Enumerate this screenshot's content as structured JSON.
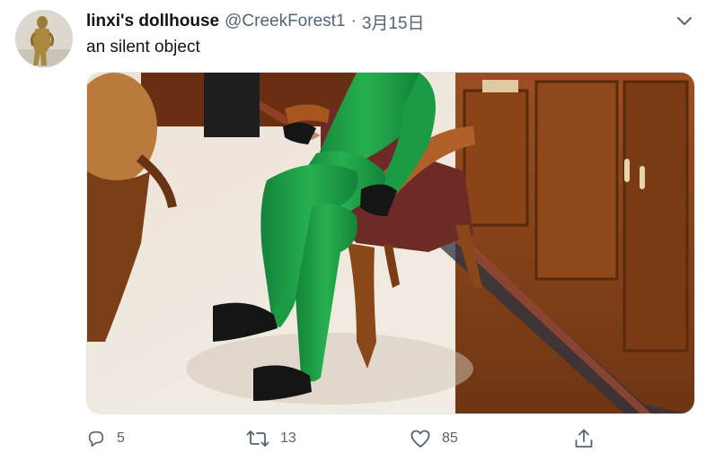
{
  "tweet": {
    "display_name": "linxi's dollhouse",
    "handle": "@CreekForest1",
    "separator": "·",
    "date": "3月15日",
    "text": "an silent object",
    "avatar_icon": "avatar-figure",
    "more_icon": "chevron-down-icon",
    "media_alt": "photo"
  },
  "actions": {
    "reply": {
      "icon": "reply-icon",
      "count": "5"
    },
    "retweet": {
      "icon": "retweet-icon",
      "count": "13"
    },
    "like": {
      "icon": "heart-icon",
      "count": "85"
    },
    "share": {
      "icon": "share-icon"
    }
  },
  "colors": {
    "text_primary": "#0f1419",
    "text_secondary": "#536471",
    "suit_green": "#1f9a3f",
    "wood": "#8a4a1f"
  }
}
